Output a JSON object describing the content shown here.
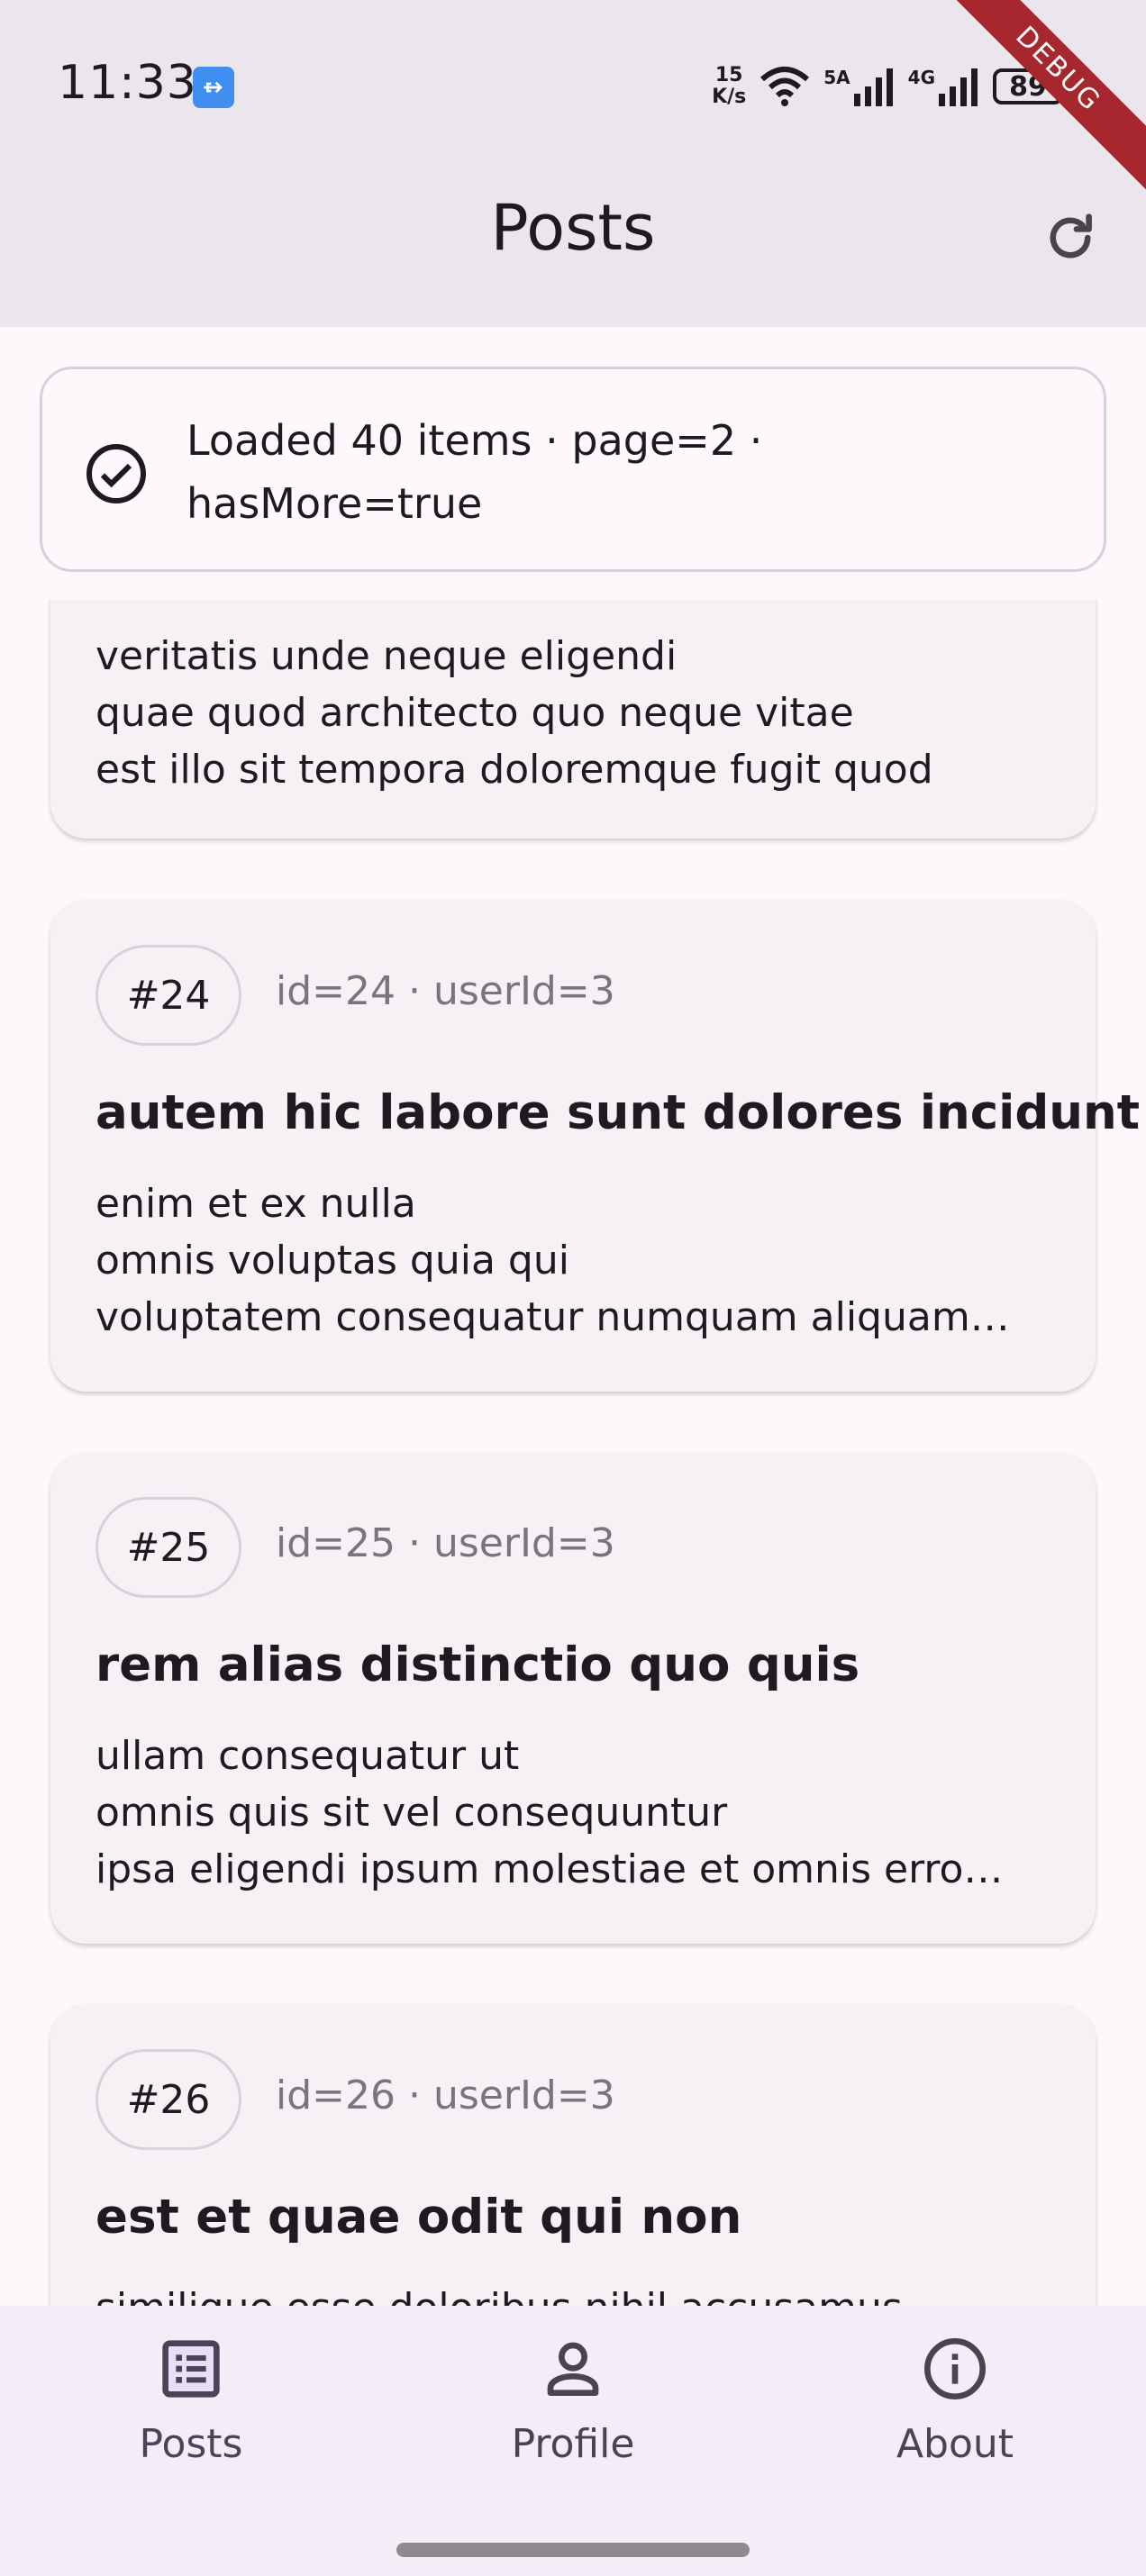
{
  "status_bar": {
    "time": "11:33",
    "net_speed_value": "15",
    "net_speed_unit": "K/s",
    "signal_1": "5A",
    "signal_2": "4G",
    "battery": "89",
    "icons": [
      "usb-icon",
      "wifi-icon",
      "signal-icon",
      "battery-icon"
    ]
  },
  "debug_banner": "DEBUG",
  "app_bar": {
    "title": "Posts",
    "refresh_icon": "refresh-icon"
  },
  "status_banner": {
    "icon": "check-circle-icon",
    "text": "Loaded 40 items · page=2 · hasMore=true"
  },
  "posts": [
    {
      "badge": "",
      "meta": "",
      "title": "",
      "body": [
        "veritatis unde neque eligendi",
        "quae quod architecto quo neque vitae",
        "est illo sit tempora doloremque fugit quod"
      ]
    },
    {
      "badge": "#24",
      "meta": "id=24 · userId=3",
      "title": "autem hic labore sunt dolores incidunt",
      "body": [
        "enim et ex nulla",
        "omnis voluptas quia qui",
        "voluptatem consequatur numquam aliquam…"
      ]
    },
    {
      "badge": "#25",
      "meta": "id=25 · userId=3",
      "title": "rem alias distinctio quo quis",
      "body": [
        "ullam consequatur ut",
        "omnis quis sit vel consequuntur",
        "ipsa eligendi ipsum molestiae et omnis erro…"
      ]
    },
    {
      "badge": "#26",
      "meta": "id=26 · userId=3",
      "title": "est et quae odit qui non",
      "body": [
        "similique esse doloribus nihil accusamus"
      ]
    }
  ],
  "bottom_nav": {
    "items": [
      {
        "label": "Posts",
        "icon": "list-icon",
        "active": true
      },
      {
        "label": "Profile",
        "icon": "person-icon",
        "active": false
      },
      {
        "label": "About",
        "icon": "info-icon",
        "active": false
      }
    ]
  },
  "colors": {
    "accent": "#4a4459",
    "app_bar_bg": "#ebe5ee",
    "card_bg": "#f7f1f6",
    "debug": "#a6272d"
  }
}
